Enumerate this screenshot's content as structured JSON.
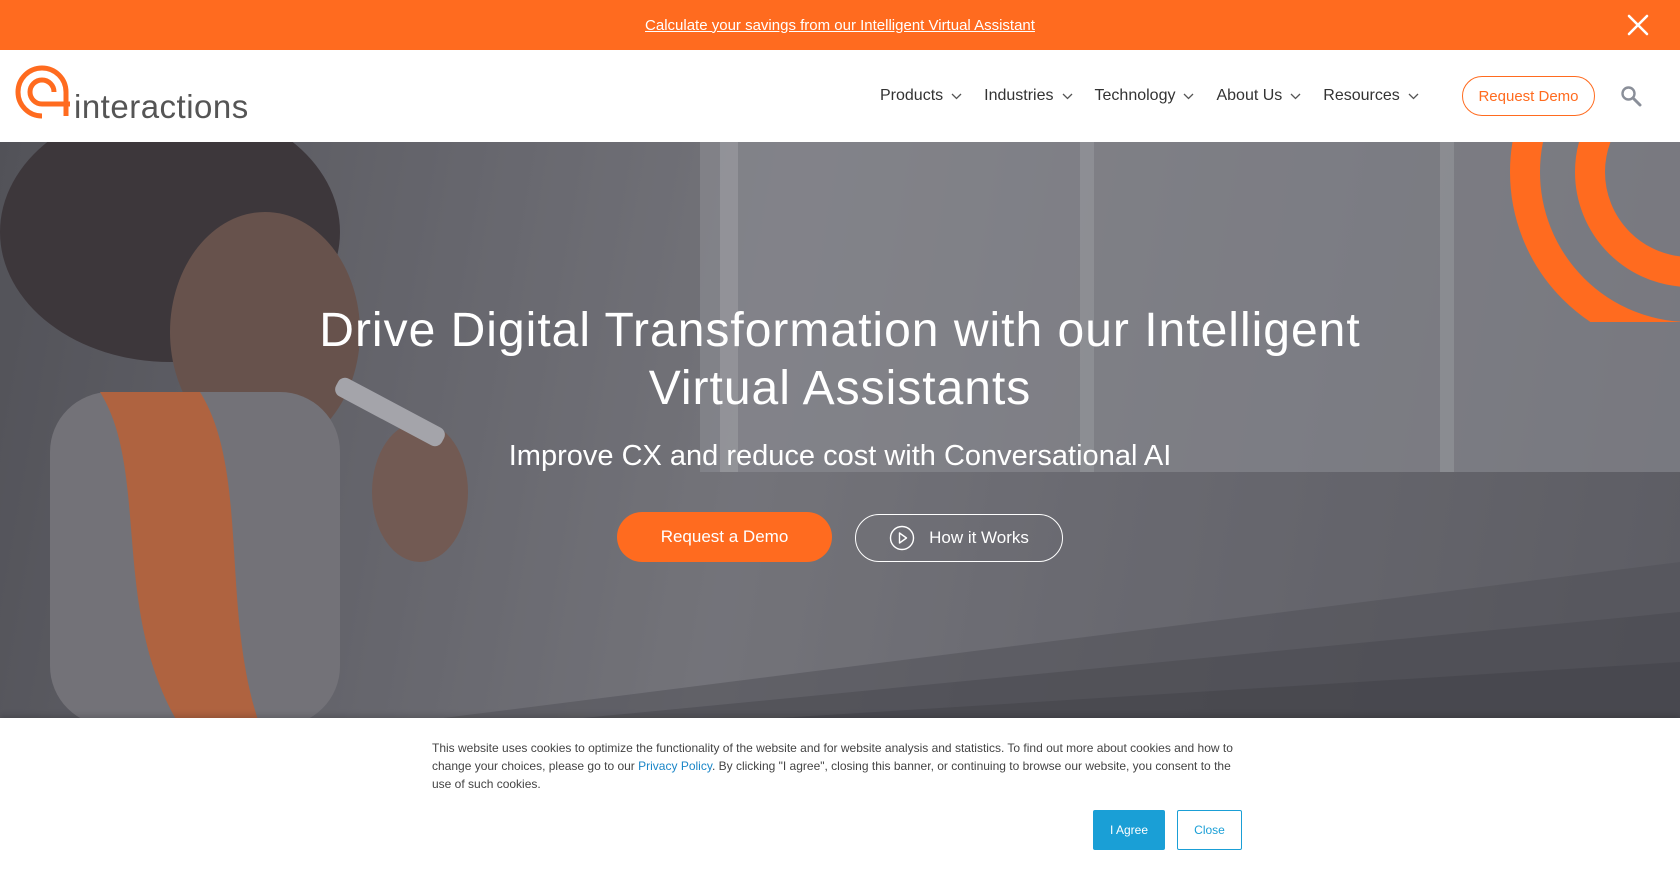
{
  "promo": {
    "link_text": "Calculate your savings from our Intelligent Virtual Assistant",
    "close_icon": "close-icon"
  },
  "header": {
    "logo_text": "interactions",
    "nav": [
      {
        "label": "Products"
      },
      {
        "label": "Industries"
      },
      {
        "label": "Technology"
      },
      {
        "label": "About Us"
      },
      {
        "label": "Resources"
      }
    ],
    "demo_label": "Request Demo",
    "search_icon": "search-icon"
  },
  "hero": {
    "title": "Drive Digital Transformation with our Intelligent Virtual Assistants",
    "subtitle": "Improve CX and reduce cost with Conversational AI",
    "demo_button": "Request a Demo",
    "how_button": "How it Works"
  },
  "cookie": {
    "text_before": "This website uses cookies to optimize the functionality of the website and for website analysis and statistics. To find out more about cookies and how to change your choices, please go to our ",
    "link_text": "Privacy Policy",
    "text_after": ". By clicking \"I agree\", closing this banner, or continuing to browse our website, you consent to the use of such cookies.",
    "agree_label": "I Agree",
    "close_label": "Close"
  },
  "colors": {
    "brand_orange": "#ff6b1f",
    "cookie_blue": "#1a9fd6"
  }
}
